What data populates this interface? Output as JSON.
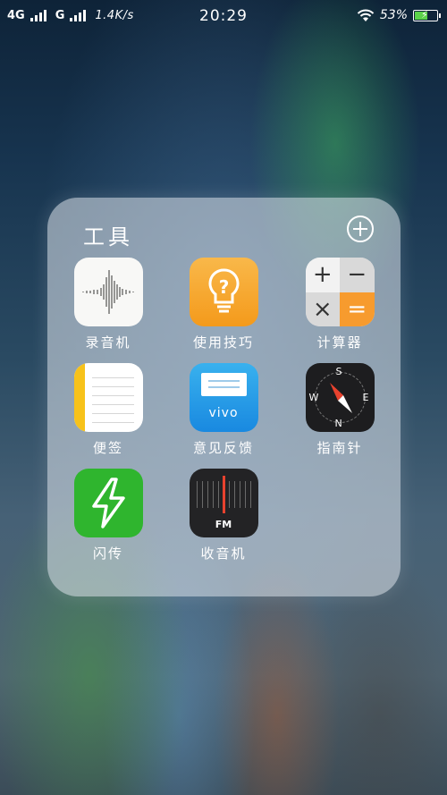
{
  "status_bar": {
    "network1": "4G",
    "network2": "G",
    "speed": "1.4K/s",
    "time": "20:29",
    "battery_percent": "53%",
    "battery_level": 0.53
  },
  "folder": {
    "title": "工具",
    "apps": [
      {
        "label": "录音机",
        "icon": "recorder-icon"
      },
      {
        "label": "使用技巧",
        "icon": "lightbulb-icon"
      },
      {
        "label": "计算器",
        "icon": "calculator-icon"
      },
      {
        "label": "便签",
        "icon": "notes-icon"
      },
      {
        "label": "意见反馈",
        "icon": "feedback-icon",
        "icon_text": "vivo"
      },
      {
        "label": "指南针",
        "icon": "compass-icon"
      },
      {
        "label": "闪传",
        "icon": "flash-icon"
      },
      {
        "label": "收音机",
        "icon": "radio-icon",
        "icon_text": "FM"
      }
    ]
  },
  "calculator_symbols": [
    "+",
    "−",
    "×",
    "="
  ],
  "compass_letters": {
    "n": "N",
    "s": "S",
    "e": "E",
    "w": "W"
  },
  "colors": {
    "tips_orange": "#f49a1b",
    "feedback_blue": "#1989e0",
    "flash_green": "#2fb52e",
    "battery_green": "#5bd24a"
  }
}
